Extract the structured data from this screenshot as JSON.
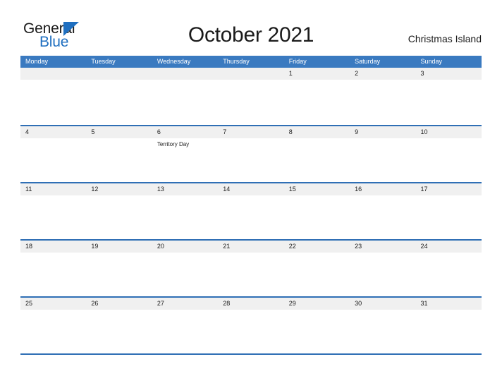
{
  "brand": {
    "name_part1": "General",
    "name_part2": "Blue",
    "triangle_color": "#1f6fc0",
    "text_color": "#1b1b1b"
  },
  "header": {
    "title": "October 2021",
    "region": "Christmas Island"
  },
  "theme": {
    "header_blue": "#3a7ac0",
    "rule_blue": "#2f6fb5",
    "band_gray": "#f0f0f0",
    "text": "#1b1b1b",
    "page_bg": "#ffffff"
  },
  "weekdays": [
    {
      "label": "Monday"
    },
    {
      "label": "Tuesday"
    },
    {
      "label": "Wednesday"
    },
    {
      "label": "Thursday"
    },
    {
      "label": "Friday"
    },
    {
      "label": "Saturday"
    },
    {
      "label": "Sunday"
    }
  ],
  "weeks": [
    {
      "days": [
        {
          "num": "",
          "events": []
        },
        {
          "num": "",
          "events": []
        },
        {
          "num": "",
          "events": []
        },
        {
          "num": "",
          "events": []
        },
        {
          "num": "1",
          "events": []
        },
        {
          "num": "2",
          "events": []
        },
        {
          "num": "3",
          "events": []
        }
      ]
    },
    {
      "days": [
        {
          "num": "4",
          "events": []
        },
        {
          "num": "5",
          "events": []
        },
        {
          "num": "6",
          "events": [
            {
              "name": "Territory Day"
            }
          ]
        },
        {
          "num": "7",
          "events": []
        },
        {
          "num": "8",
          "events": []
        },
        {
          "num": "9",
          "events": []
        },
        {
          "num": "10",
          "events": []
        }
      ]
    },
    {
      "days": [
        {
          "num": "11",
          "events": []
        },
        {
          "num": "12",
          "events": []
        },
        {
          "num": "13",
          "events": []
        },
        {
          "num": "14",
          "events": []
        },
        {
          "num": "15",
          "events": []
        },
        {
          "num": "16",
          "events": []
        },
        {
          "num": "17",
          "events": []
        }
      ]
    },
    {
      "days": [
        {
          "num": "18",
          "events": []
        },
        {
          "num": "19",
          "events": []
        },
        {
          "num": "20",
          "events": []
        },
        {
          "num": "21",
          "events": []
        },
        {
          "num": "22",
          "events": []
        },
        {
          "num": "23",
          "events": []
        },
        {
          "num": "24",
          "events": []
        }
      ]
    },
    {
      "days": [
        {
          "num": "25",
          "events": []
        },
        {
          "num": "26",
          "events": []
        },
        {
          "num": "27",
          "events": []
        },
        {
          "num": "28",
          "events": []
        },
        {
          "num": "29",
          "events": []
        },
        {
          "num": "30",
          "events": []
        },
        {
          "num": "31",
          "events": []
        }
      ]
    }
  ]
}
